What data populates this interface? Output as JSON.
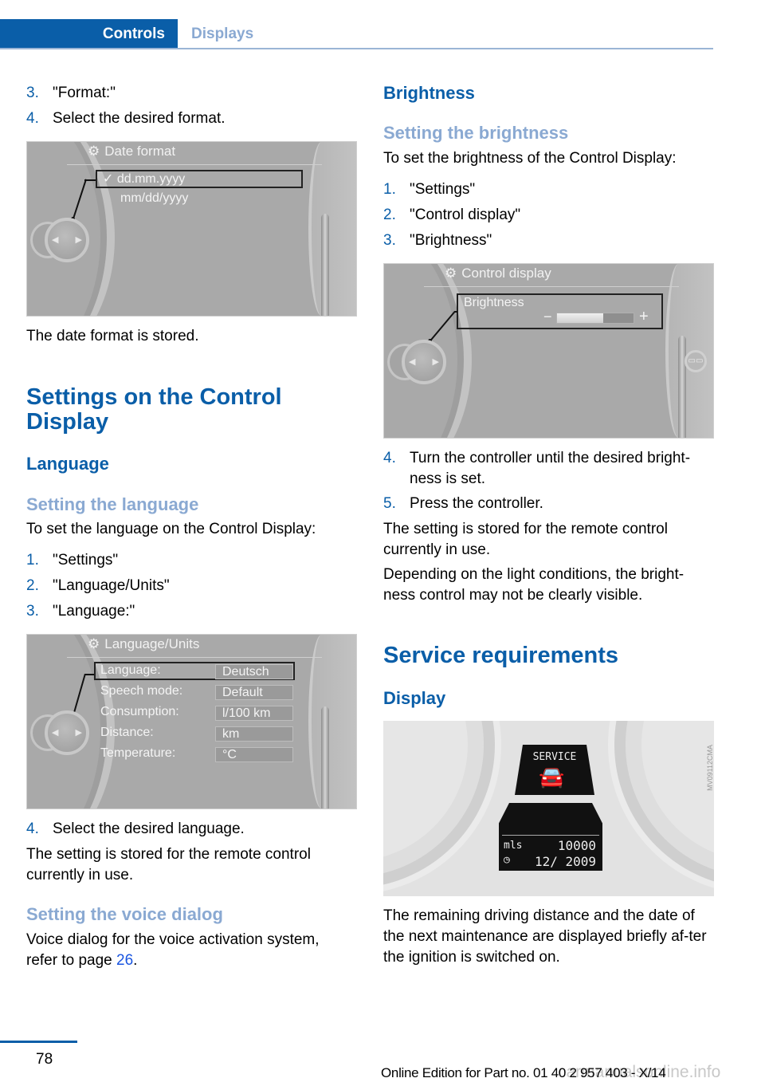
{
  "header": {
    "tabs": [
      {
        "label": "Controls",
        "active": true
      },
      {
        "label": "Displays",
        "active": false
      }
    ]
  },
  "left": {
    "steps_top": [
      {
        "num": "3.",
        "text": "\"Format:\""
      },
      {
        "num": "4.",
        "text": "Select the desired format."
      }
    ],
    "date_screen": {
      "title": "Date format",
      "icon": "gear-icon",
      "options": [
        {
          "label": "dd.mm.yyyy",
          "selected": true
        },
        {
          "label": "mm/dd/yyyy",
          "selected": false
        }
      ]
    },
    "date_stored": "The date format is stored.",
    "section_title": "Settings on the Control Display",
    "language_heading": "Language",
    "setting_language_heading": "Setting the language",
    "setting_language_intro": "To set the language on the Control Display:",
    "language_steps": [
      {
        "num": "1.",
        "text": "\"Settings\""
      },
      {
        "num": "2.",
        "text": "\"Language/Units\""
      },
      {
        "num": "3.",
        "text": "\"Language:\""
      }
    ],
    "language_screen": {
      "title": "Language/Units",
      "rows": [
        {
          "label": "Language:",
          "value": "Deutsch",
          "selected": true
        },
        {
          "label": "Speech mode:",
          "value": "Default",
          "selected": false
        },
        {
          "label": "Consumption:",
          "value": "l/100 km",
          "selected": false
        },
        {
          "label": "Distance:",
          "value": "km",
          "selected": false
        },
        {
          "label": "Temperature:",
          "value": "°C",
          "selected": false
        }
      ]
    },
    "language_step4": {
      "num": "4.",
      "text": "Select the desired language."
    },
    "language_stored": "The setting is stored for the remote control currently in use.",
    "voice_heading": "Setting the voice dialog",
    "voice_text": "Voice dialog for the voice activation system, refer to page ",
    "voice_link": "26",
    "voice_end": "."
  },
  "right": {
    "brightness_heading": "Brightness",
    "setting_brightness_heading": "Setting the brightness",
    "brightness_intro": "To set the brightness of the Control Display:",
    "brightness_steps": [
      {
        "num": "1.",
        "text": "\"Settings\""
      },
      {
        "num": "2.",
        "text": "\"Control display\""
      },
      {
        "num": "3.",
        "text": "\"Brightness\""
      }
    ],
    "brightness_screen": {
      "title": "Control display",
      "item": "Brightness",
      "minus": "−",
      "plus": "+",
      "level_fraction": 0.6
    },
    "brightness_steps_after": [
      {
        "num": "4.",
        "text": "Turn the controller until the desired bright-ness is set."
      },
      {
        "num": "5.",
        "text": "Press the controller."
      }
    ],
    "brightness_stored": "The setting is stored for the remote control currently in use.",
    "brightness_note": "Depending on the light conditions, the bright-ness control may not be clearly visible.",
    "service_title": "Service requirements",
    "display_heading": "Display",
    "service_display": {
      "label": "SERVICE",
      "distance_unit": "mls",
      "distance_value": "10000",
      "date_value": "12/ 2009",
      "image_code": "MV09112CMA"
    },
    "service_text": "The remaining driving distance and the date of the next maintenance are displayed briefly af-ter the ignition is switched on."
  },
  "footer": {
    "page_number": "78",
    "edition": "Online Edition for Part no. 01 40 2 957 403 - X/14",
    "watermark": "carmanualsonline.info"
  }
}
